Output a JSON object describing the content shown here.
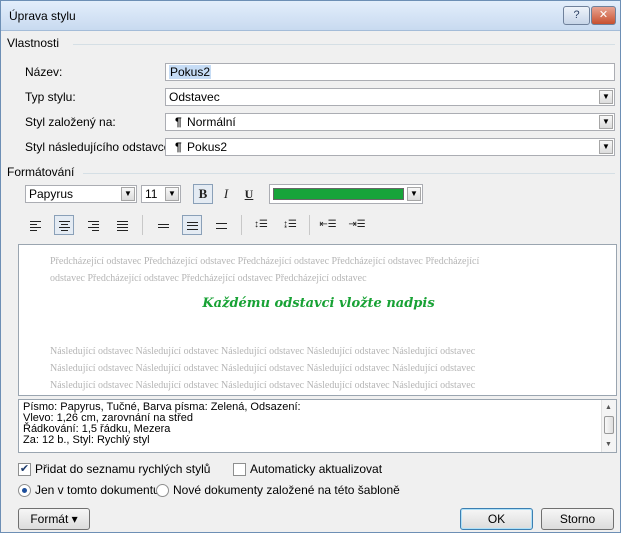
{
  "window": {
    "title": "Úprava stylu",
    "help_label": "?",
    "close_label": "✕"
  },
  "properties": {
    "section_label": "Vlastnosti",
    "name_label": "Název:",
    "name_value": "Pokus2",
    "type_label": "Typ stylu:",
    "type_value": "Odstavec",
    "based_on_label": "Styl založený na:",
    "based_on_value": "Normální",
    "next_label": "Styl následujícího odstavce:",
    "next_value": "Pokus2",
    "para_mark": "¶"
  },
  "formatting": {
    "section_label": "Formátování",
    "font_value": "Papyrus",
    "size_value": "11",
    "bold_label": "B",
    "italic_label": "I",
    "underline_label": "U",
    "font_color": "#17a43a",
    "line_spacing_icons": [
      "line-spacing-1",
      "line-spacing-1-5",
      "line-spacing-2"
    ]
  },
  "preview": {
    "prev_lines": [
      "Předcházející odstavec Předcházející odstavec Předcházející odstavec Předcházející odstavec Předcházející",
      "odstavec Předcházející odstavec Předcházející odstavec Předcházející odstavec"
    ],
    "sample_text": "Každému odstavci vložte nadpis",
    "next_lines": [
      "Následující odstavec Následující odstavec Následující odstavec Následující odstavec Následující odstavec",
      "Následující odstavec Následující odstavec Následující odstavec Následující odstavec Následující odstavec",
      "Následující odstavec Následující odstavec Následující odstavec Následující odstavec Následující odstavec"
    ]
  },
  "description": {
    "lines": [
      "Písmo: Papyrus, Tučné, Barva písma: Zelená, Odsazení:",
      "   Vlevo:  1,26 cm, zarovnání na střed",
      "   Řádkování:  1,5 řádku, Mezera",
      "   Za:  12 b., Styl: Rychlý styl"
    ]
  },
  "options": {
    "add_quick_label": "Přidat do seznamu rychlých stylů",
    "add_quick_checked": true,
    "auto_update_label": "Automaticky aktualizovat",
    "auto_update_checked": false,
    "only_doc_label": "Jen v tomto dokumentu",
    "new_docs_label": "Nové dokumenty založené na této šabloně"
  },
  "buttons": {
    "format_label": "Formát ▾",
    "ok_label": "OK",
    "cancel_label": "Storno"
  }
}
